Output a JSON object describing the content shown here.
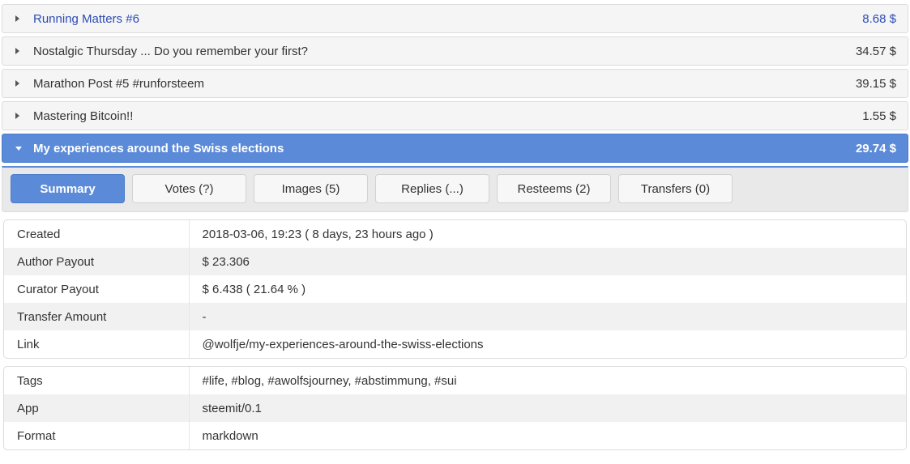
{
  "accordion": {
    "rows": [
      {
        "title": "Running Matters #6",
        "amount": "8.68 $",
        "state": "collapsed",
        "style": "link",
        "caret": "caret-right-icon"
      },
      {
        "title": "Nostalgic Thursday ... Do you remember your first?",
        "amount": "34.57 $",
        "state": "collapsed",
        "style": "normal",
        "caret": "caret-right-icon"
      },
      {
        "title": "Marathon Post #5 #runforsteem",
        "amount": "39.15 $",
        "state": "collapsed",
        "style": "normal",
        "caret": "caret-right-icon"
      },
      {
        "title": "Mastering Bitcoin!!",
        "amount": "1.55 $",
        "state": "collapsed",
        "style": "normal",
        "caret": "caret-right-icon"
      },
      {
        "title": "My experiences around the Swiss elections",
        "amount": "29.74 $",
        "state": "expanded",
        "style": "active",
        "caret": "caret-down-icon"
      }
    ]
  },
  "tabs": [
    {
      "label": "Summary",
      "active": true
    },
    {
      "label": "Votes (?)",
      "active": false
    },
    {
      "label": "Images (5)",
      "active": false
    },
    {
      "label": "Replies (...)",
      "active": false
    },
    {
      "label": "Resteems (2)",
      "active": false
    },
    {
      "label": "Transfers (0)",
      "active": false
    }
  ],
  "summary_table": {
    "rows": [
      {
        "key": "Created",
        "value": "2018-03-06, 19:23   ( 8 days, 23 hours ago )",
        "link": false
      },
      {
        "key": "Author Payout",
        "value": "$ 23.306",
        "link": false
      },
      {
        "key": "Curator Payout",
        "value": "$ 6.438   ( 21.64 % )",
        "link": false
      },
      {
        "key": "Transfer Amount",
        "value": "-",
        "link": false
      },
      {
        "key": "Link",
        "value": "@wolfje/my-experiences-around-the-swiss-elections",
        "link": true
      }
    ]
  },
  "meta_table": {
    "rows": [
      {
        "key": "Tags",
        "value": "#life, #blog, #awolfsjourney, #abstimmung, #sui",
        "link": true
      },
      {
        "key": "App",
        "value": "steemit/0.1",
        "link": false
      },
      {
        "key": "Format",
        "value": "markdown",
        "link": false
      }
    ]
  },
  "colors": {
    "accent": "#5b8ad9",
    "link": "#2c4bb5",
    "row_bg": "#f5f5f5",
    "tabbar_bg": "#e9e9e9",
    "stripe": "#f1f1f1"
  }
}
